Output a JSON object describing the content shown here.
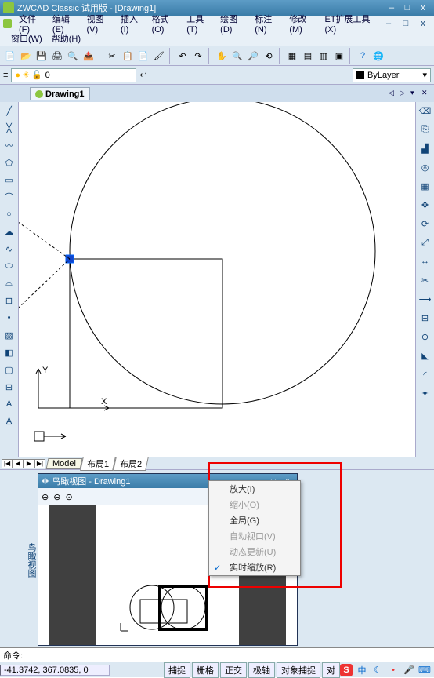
{
  "title": "ZWCAD Classic 试用版 - [Drawing1]",
  "win_buttons": {
    "min": "–",
    "max": "□",
    "close": "x"
  },
  "menu": [
    "文件(F)",
    "编辑(E)",
    "视图(V)",
    "插入(I)",
    "格式(O)",
    "工具(T)",
    "绘图(D)",
    "标注(N)",
    "修改(M)",
    "ET扩展工具(X)"
  ],
  "menu2": [
    "窗口(W)",
    "帮助(H)"
  ],
  "layer_label": "ByLayer",
  "tab_name": "Drawing1",
  "axis": {
    "x": "X",
    "y": "Y"
  },
  "sheets": {
    "model": "Model",
    "l1": "布局1",
    "l2": "布局2"
  },
  "sheet_nav": [
    "|◀",
    "◀",
    "▶",
    "▶|"
  ],
  "panel_side_text": "鸟瞰视图",
  "aerial_title": "鸟瞰视图 - Drawing1",
  "ctx": {
    "放大": "放大(I)",
    "缩小": "缩小(O)",
    "全局": "全局(G)",
    "自动视口": "自动视口(V)",
    "动态更新": "动态更新(U)",
    "实时缩放": "实时缩放(R)"
  },
  "cmd_prompt": "命令:",
  "coord": "-41.3742, 367.0835, 0",
  "status_btns": [
    "捕捉",
    "栅格",
    "正交",
    "极轴",
    "对象捕捉",
    "对"
  ],
  "tray": {
    "ime": "S",
    "lang": "中"
  }
}
